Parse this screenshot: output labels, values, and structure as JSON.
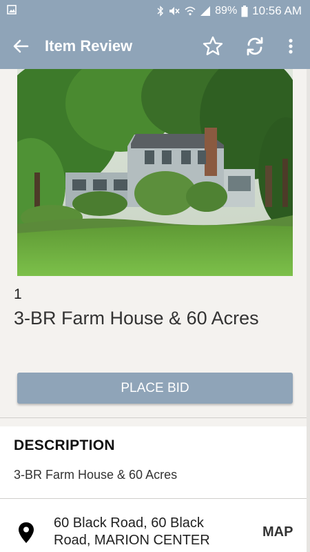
{
  "status_bar": {
    "battery": "89%",
    "time": "10:56 AM"
  },
  "app_bar": {
    "title": "Item Review",
    "icons": [
      "back-arrow-icon",
      "star-icon",
      "refresh-icon",
      "more-vert-icon"
    ]
  },
  "item": {
    "photo_alt": "Farm house among trees with green lawn",
    "lot_number": "1",
    "title": "3-BR Farm House & 60 Acres",
    "bid_button": "PLACE BID"
  },
  "description": {
    "heading": "DESCRIPTION",
    "text": "3-BR Farm House & 60 Acres"
  },
  "location": {
    "address": "60 Black Road, 60 Black Road, MARION CENTER",
    "map_label": "MAP"
  },
  "colors": {
    "brand": "#8fa4b8",
    "background": "#f4f2ef"
  }
}
